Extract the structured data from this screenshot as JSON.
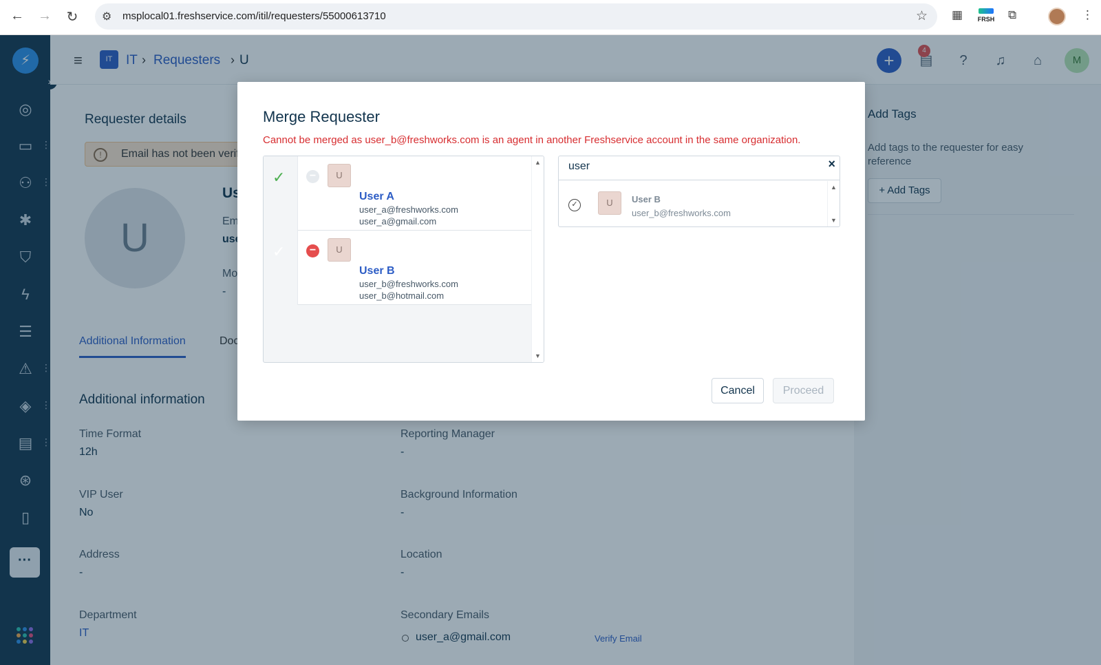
{
  "browser": {
    "url": "msplocal01.freshservice.com/itil/requesters/55000613710",
    "ext_label": "FRSH"
  },
  "topbar": {
    "module_badge": "IT",
    "breadcrumb": [
      "IT",
      "Requesters",
      "U"
    ],
    "help_count": "4",
    "avatar_initial": "M"
  },
  "page": {
    "section_title": "Requester details",
    "email_warning": "Email has not been verifi",
    "avatar_initial": "U",
    "name_partial": "Us",
    "email_label_partial": "Em",
    "email_value_partial": "use",
    "mobile_label_partial": "Mo",
    "mobile_value": "-",
    "tabs": [
      "Additional Information",
      "Doc"
    ],
    "info_title": "Additional information",
    "fields": {
      "time_format": {
        "label": "Time Format",
        "value": "12h"
      },
      "reporting_manager": {
        "label": "Reporting Manager",
        "value": "-"
      },
      "vip_user": {
        "label": "VIP User",
        "value": "No"
      },
      "background_info": {
        "label": "Background Information",
        "value": "-"
      },
      "address": {
        "label": "Address",
        "value": "-"
      },
      "location": {
        "label": "Location",
        "value": "-"
      },
      "department": {
        "label": "Department",
        "value": "IT"
      },
      "secondary_emails": {
        "label": "Secondary Emails",
        "value": "user_a@gmail.com",
        "action": "Verify Email"
      }
    }
  },
  "right_pane": {
    "title": "Add Tags",
    "description": "Add tags to the requester for easy reference",
    "button": "+ Add Tags"
  },
  "modal": {
    "title": "Merge Requester",
    "error": "Cannot be merged as user_b@freshworks.com is an agent in another Freshservice account in the same organization.",
    "selected": [
      {
        "initial": "U",
        "name": "User A",
        "emails": [
          "user_a@freshworks.com",
          "user_a@gmail.com"
        ],
        "primary": true
      },
      {
        "initial": "U",
        "name": "User B",
        "emails": [
          "user_b@freshworks.com",
          "user_b@hotmail.com"
        ],
        "primary": false
      }
    ],
    "search_value": "user",
    "results": [
      {
        "initial": "U",
        "name": "User B",
        "email": "user_b@freshworks.com"
      }
    ],
    "cancel_label": "Cancel",
    "proceed_label": "Proceed"
  },
  "colors": {
    "accent": "#2c5cc5",
    "sidebar": "#12344d",
    "error": "#d72d30",
    "success_check": "#4caf50",
    "remove": "#e54d4d"
  }
}
